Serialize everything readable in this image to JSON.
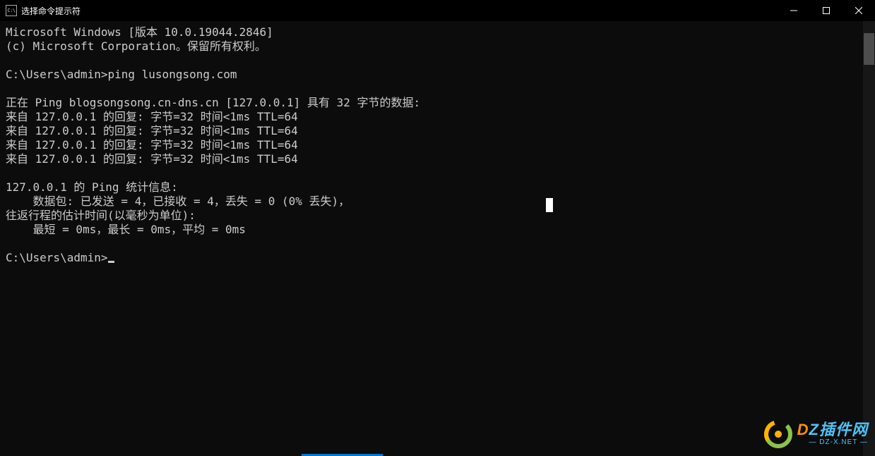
{
  "titlebar": {
    "icon_text": "C:\\",
    "title": "选择命令提示符"
  },
  "terminal": {
    "lines": [
      "Microsoft Windows [版本 10.0.19044.2846]",
      "(c) Microsoft Corporation。保留所有权利。",
      "",
      "C:\\Users\\admin>ping lusongsong.com",
      "",
      "正在 Ping blogsongsong.cn-dns.cn [127.0.0.1] 具有 32 字节的数据:",
      "来自 127.0.0.1 的回复: 字节=32 时间<1ms TTL=64",
      "来自 127.0.0.1 的回复: 字节=32 时间<1ms TTL=64",
      "来自 127.0.0.1 的回复: 字节=32 时间<1ms TTL=64",
      "来自 127.0.0.1 的回复: 字节=32 时间<1ms TTL=64",
      "",
      "127.0.0.1 的 Ping 统计信息:",
      "    数据包: 已发送 = 4，已接收 = 4，丢失 = 0 (0% 丢失)，",
      "往返行程的估计时间(以毫秒为单位):",
      "    最短 = 0ms，最长 = 0ms，平均 = 0ms",
      ""
    ],
    "prompt": "C:\\Users\\admin>"
  },
  "watermark": {
    "main_prefix": "D",
    "main_rest": "Z插件网",
    "sub": "— DZ-X.NET —"
  }
}
